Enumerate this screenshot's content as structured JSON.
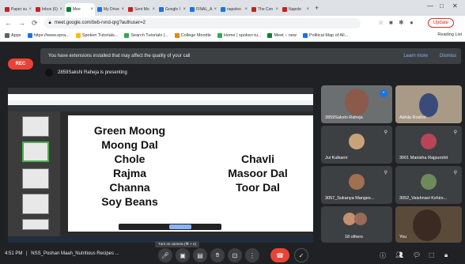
{
  "browser": {
    "tabs": [
      {
        "label": "Paper su",
        "color": "#c5221f"
      },
      {
        "label": "Inbox (6)",
        "color": "#c5221f"
      },
      {
        "label": "Mee",
        "color": "#00832d",
        "active": true
      },
      {
        "label": "My Drive",
        "color": "#1a73e8"
      },
      {
        "label": "Sent Mo",
        "color": "#c5221f"
      },
      {
        "label": "Google I",
        "color": "#1a73e8"
      },
      {
        "label": "FINAL_A",
        "color": "#1a73e8"
      },
      {
        "label": "napoleo",
        "color": "#1a73e8"
      },
      {
        "label": "The Con",
        "color": "#c5221f"
      },
      {
        "label": "Napole",
        "color": "#c5221f"
      }
    ],
    "url": "meet.google.com/bxb-rvnd-qrg?authuser=2",
    "update_label": "Update",
    "bookmarks": [
      {
        "label": "Apps",
        "color": "#5f6368"
      },
      {
        "label": "https://www.epra...",
        "color": "#1a73e8"
      },
      {
        "label": "Spoken Tutorials...",
        "color": "#fbbc04"
      },
      {
        "label": "Search Tutorials |...",
        "color": "#34a853"
      },
      {
        "label": "College Moodle",
        "color": "#ea8600"
      },
      {
        "label": "Home | spoken tu...",
        "color": "#34a853"
      },
      {
        "label": "Meet – new",
        "color": "#00832d"
      },
      {
        "label": "Political Map of All...",
        "color": "#1a73e8"
      }
    ],
    "reading_list": "Reading List"
  },
  "meet": {
    "rec_label": "REC",
    "banner_text": "You have extensions installed that may affect the quality of your call",
    "learn_more": "Learn more",
    "dismiss": "Dismiss",
    "presenting_text": "2859Sakshi Raheja is presenting",
    "tooltip": "Turn on camera (⌘ + e)",
    "time": "4:51 PM",
    "meeting_name": "NSS_Poshan Maah_Nutritious Recipes ...",
    "others_label": "18 others"
  },
  "slide": {
    "left_items": [
      "Green Moong",
      "Moong Dal",
      "Chole",
      "Rajma",
      "Channa",
      "Soy Beans"
    ],
    "right_items": [
      "Chavli",
      "Masoor Dal",
      "Toor Dal"
    ]
  },
  "participants": [
    {
      "name": "2859Sakshi Raheja"
    },
    {
      "name": "Akhila Roshni"
    },
    {
      "name": "Jui Kulkarni"
    },
    {
      "name": "3001 Manisha Rajpurohit"
    },
    {
      "name": "3057_Sukanya Manges..."
    },
    {
      "name": "3052_Vaishnavi Kshirs..."
    },
    {
      "name": "You"
    }
  ]
}
